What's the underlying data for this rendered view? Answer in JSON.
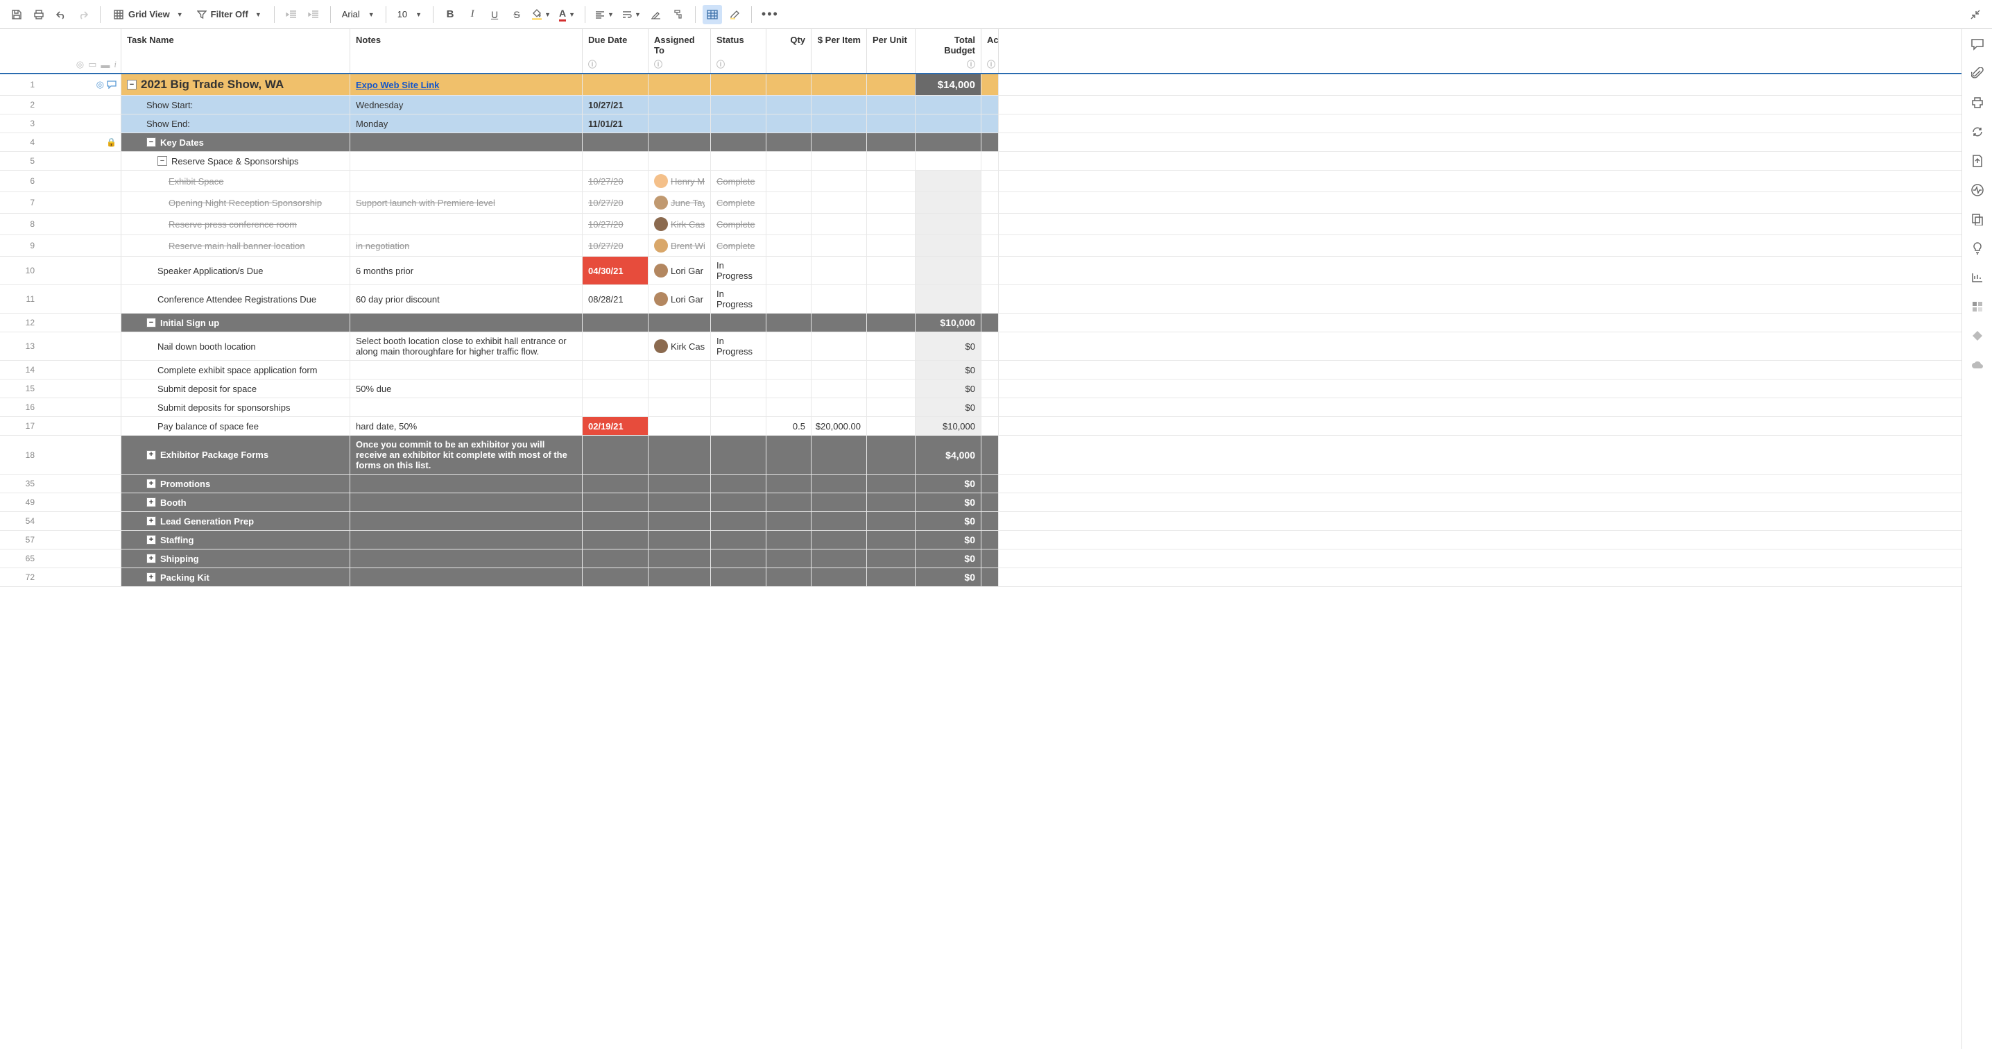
{
  "toolbar": {
    "grid_view": "Grid View",
    "filter_off": "Filter Off",
    "font": "Arial",
    "font_size": "10"
  },
  "headers": {
    "task": "Task Name",
    "notes": "Notes",
    "due": "Due Date",
    "assigned": "Assigned To",
    "status": "Status",
    "qty": "Qty",
    "price": "$ Per Item",
    "unit": "Per Unit",
    "budget": "Total Budget",
    "ac": "Ac"
  },
  "rows": [
    {
      "num": "1",
      "style": "section-gold",
      "toggle": "-",
      "indent": 0,
      "task": "2021 Big Trade Show, WA",
      "notes": "Expo Web Site Link",
      "notes_link": true,
      "budget": "$14,000",
      "attach": true,
      "comment": true
    },
    {
      "num": "2",
      "style": "lightblue",
      "indent": 1,
      "task": "Show Start:",
      "notes": "Wednesday",
      "due": "10/27/21",
      "due_bold": true
    },
    {
      "num": "3",
      "style": "lightblue",
      "indent": 1,
      "task": "Show End:",
      "notes": "Monday",
      "due": "11/01/21",
      "due_bold": true
    },
    {
      "num": "4",
      "style": "darkgray",
      "toggle": "-",
      "indent": 1,
      "task": "Key Dates",
      "lock": true
    },
    {
      "num": "5",
      "indent": 2,
      "toggle": "-",
      "task": "Reserve Space & Sponsorships"
    },
    {
      "num": "6",
      "indent": 3,
      "strike": true,
      "task": "Exhibit Space",
      "due": "10/27/20",
      "assigned": "Henry M",
      "avatar": "a",
      "status": "Complete",
      "budget_gray": true
    },
    {
      "num": "7",
      "indent": 3,
      "strike": true,
      "task": "Opening Night Reception Sponsorship",
      "notes": "Support launch with Premiere level",
      "due": "10/27/20",
      "assigned": "June Tay",
      "avatar": "b",
      "status": "Complete",
      "budget_gray": true
    },
    {
      "num": "8",
      "indent": 3,
      "strike": true,
      "task": "Reserve press conference room",
      "due": "10/27/20",
      "assigned": "Kirk Cas",
      "avatar": "c",
      "status": "Complete",
      "budget_gray": true
    },
    {
      "num": "9",
      "indent": 3,
      "strike": true,
      "task": "Reserve main hall banner location",
      "notes": "in negotiation",
      "due": "10/27/20",
      "assigned": "Brent Wi",
      "avatar": "d",
      "status": "Complete",
      "budget_gray": true
    },
    {
      "num": "10",
      "indent": 2,
      "task": "Speaker Application/s Due",
      "notes": "6 months prior",
      "due": "04/30/21",
      "due_red": true,
      "assigned": "Lori Gar",
      "avatar": "e",
      "status": "In Progress",
      "budget_gray": true
    },
    {
      "num": "11",
      "indent": 2,
      "task": "Conference Attendee Registrations Due",
      "notes": "60 day prior discount",
      "due": "08/28/21",
      "assigned": "Lori Gar",
      "avatar": "e",
      "status": "In Progress",
      "budget_gray": true
    },
    {
      "num": "12",
      "style": "darkgray",
      "toggle": "-",
      "indent": 1,
      "task": "Initial Sign up",
      "budget": "$10,000"
    },
    {
      "num": "13",
      "indent": 2,
      "task": "Nail down booth location",
      "notes": "Select booth location close to exhibit hall entrance or along main thoroughfare for higher traffic flow.",
      "assigned": "Kirk Cas",
      "avatar": "c",
      "status": "In Progress",
      "budget": "$0",
      "budget_gray": true
    },
    {
      "num": "14",
      "indent": 2,
      "task": "Complete exhibit space application form",
      "budget": "$0",
      "budget_gray": true
    },
    {
      "num": "15",
      "indent": 2,
      "task": "Submit deposit for space",
      "notes": "50% due",
      "budget": "$0",
      "budget_gray": true
    },
    {
      "num": "16",
      "indent": 2,
      "task": "Submit deposits for sponsorships",
      "budget": "$0",
      "budget_gray": true
    },
    {
      "num": "17",
      "indent": 2,
      "task": "Pay balance of space fee",
      "notes": "hard date, 50%",
      "due": "02/19/21",
      "due_red": true,
      "qty": "0.5",
      "price": "$20,000.00",
      "budget": "$10,000",
      "budget_gray": true
    },
    {
      "num": "18",
      "style": "darkgray",
      "toggle": "+",
      "indent": 1,
      "task": "Exhibitor Package Forms",
      "notes": "Once you commit to be an exhibitor you will receive an exhibitor kit complete with most of the forms on this list.",
      "budget": "$4,000"
    },
    {
      "num": "35",
      "style": "darkgray",
      "toggle": "+",
      "indent": 1,
      "task": "Promotions",
      "budget": "$0"
    },
    {
      "num": "49",
      "style": "darkgray",
      "toggle": "+",
      "indent": 1,
      "task": "Booth",
      "budget": "$0"
    },
    {
      "num": "54",
      "style": "darkgray",
      "toggle": "+",
      "indent": 1,
      "task": "Lead Generation Prep",
      "budget": "$0"
    },
    {
      "num": "57",
      "style": "darkgray",
      "toggle": "+",
      "indent": 1,
      "task": "Staffing",
      "budget": "$0"
    },
    {
      "num": "65",
      "style": "darkgray",
      "toggle": "+",
      "indent": 1,
      "task": "Shipping",
      "budget": "$0"
    },
    {
      "num": "72",
      "style": "darkgray",
      "toggle": "+",
      "indent": 1,
      "task": "Packing Kit",
      "budget": "$0"
    }
  ]
}
